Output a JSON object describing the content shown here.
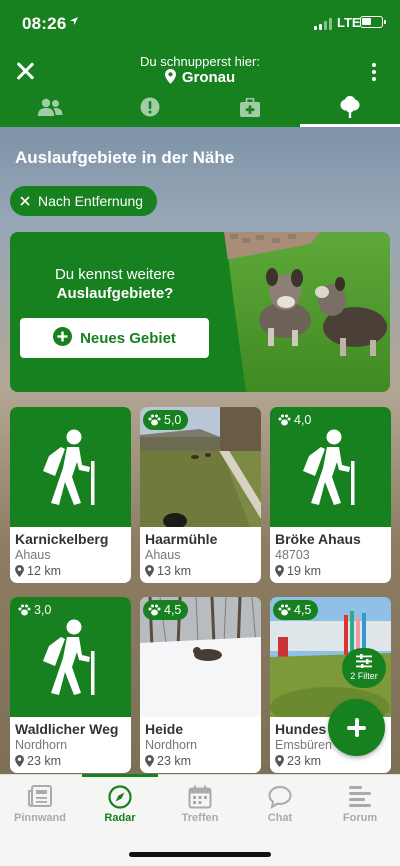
{
  "status": {
    "time": "08:26",
    "network": "LTE"
  },
  "header": {
    "subtitle": "Du schnupperst hier:",
    "place": "Gronau"
  },
  "tabs": [
    {
      "icon": "people-icon"
    },
    {
      "icon": "alert-icon"
    },
    {
      "icon": "medical-kit-icon"
    },
    {
      "icon": "tree-icon",
      "active": true
    }
  ],
  "section": {
    "title": "Auslaufgebiete in der Nähe",
    "chip_label": "Nach Entfernung"
  },
  "promo": {
    "line1": "Du kennst weitere",
    "line2": "Auslaufgebiete?",
    "button_label": "Neues Gebiet"
  },
  "cards": [
    {
      "title": "Karnickelberg",
      "sub": "Ahaus",
      "dist": "12 km",
      "rating": null,
      "thumb": "hiker"
    },
    {
      "title": "Haarmühle",
      "sub": "Ahaus",
      "dist": "13 km",
      "rating": "5,0",
      "thumb": "photo-field"
    },
    {
      "title": "Bröke Ahaus",
      "sub": "48703",
      "dist": "19 km",
      "rating": "4,0",
      "thumb": "hiker"
    },
    {
      "title": "Waldlicher Weg",
      "sub": "Nordhorn",
      "dist": "23 km",
      "rating": "3,0",
      "thumb": "hiker"
    },
    {
      "title": "Heide",
      "sub": "Nordhorn",
      "dist": "23 km",
      "rating": "4,5",
      "thumb": "photo-snow"
    },
    {
      "title": "Hundes",
      "sub": "Emsbüren",
      "dist": "23 km",
      "rating": "4,5",
      "thumb": "photo-park"
    }
  ],
  "filter": {
    "label": "2 Filter"
  },
  "nav": [
    {
      "label": "Pinnwand",
      "icon": "newspaper-icon"
    },
    {
      "label": "Radar",
      "icon": "compass-icon",
      "active": true
    },
    {
      "label": "Treffen",
      "icon": "calendar-icon"
    },
    {
      "label": "Chat",
      "icon": "chat-bubble-icon"
    },
    {
      "label": "Forum",
      "icon": "forum-icon"
    }
  ],
  "colors": {
    "brand": "#17801f",
    "nav_inactive": "#aaaaaa",
    "background": "#f4f4f2"
  }
}
